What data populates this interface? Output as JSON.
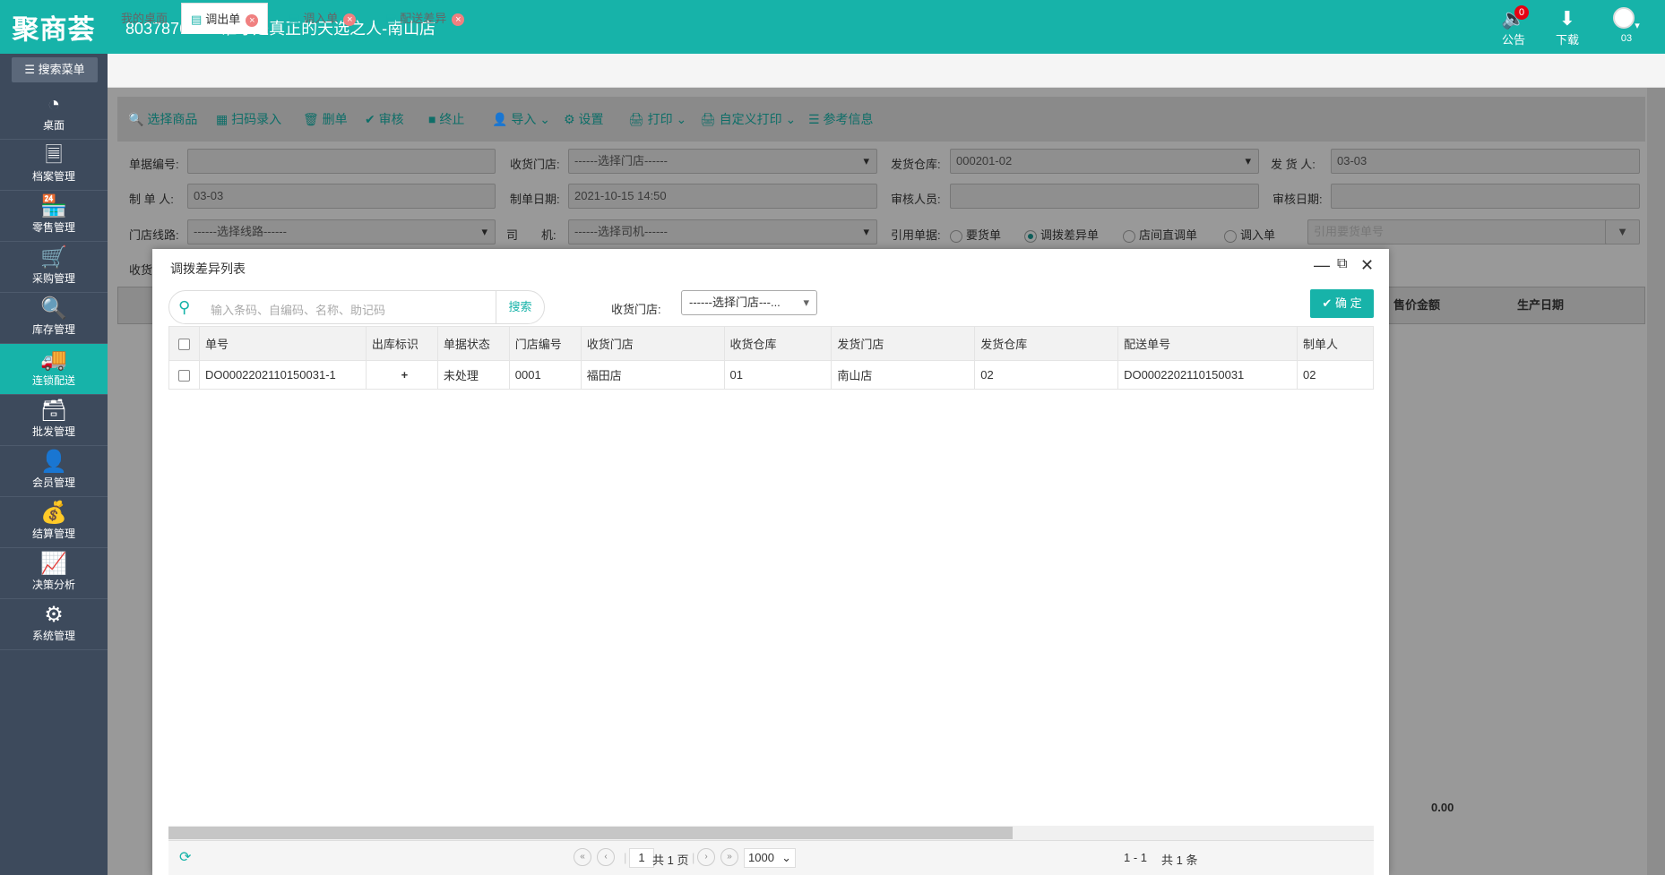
{
  "header": {
    "logo": "聚商荟",
    "title": "8037876350-谁才是真正的天选之人-南山店",
    "notice_label": "公告",
    "notice_count": "0",
    "download_label": "下载",
    "user_label": "03"
  },
  "sidebar": {
    "search_label": "搜索菜单",
    "items": [
      {
        "label": "桌面",
        "icon": "dashboard-icon"
      },
      {
        "label": "档案管理",
        "icon": "archive-icon"
      },
      {
        "label": "零售管理",
        "icon": "store-icon"
      },
      {
        "label": "采购管理",
        "icon": "cart-icon"
      },
      {
        "label": "库存管理",
        "icon": "inventory-icon"
      },
      {
        "label": "连锁配送",
        "icon": "truck-icon"
      },
      {
        "label": "批发管理",
        "icon": "wholesale-icon"
      },
      {
        "label": "会员管理",
        "icon": "member-icon"
      },
      {
        "label": "结算管理",
        "icon": "settlement-icon"
      },
      {
        "label": "决策分析",
        "icon": "chart-icon"
      },
      {
        "label": "系统管理",
        "icon": "gear-icon"
      }
    ]
  },
  "tabs": [
    {
      "label": "我的桌面"
    },
    {
      "label": "调出单"
    },
    {
      "label": "调入单"
    },
    {
      "label": "配送差异"
    }
  ],
  "toolbar": {
    "select_goods": "选择商品",
    "scan_entry": "扫码录入",
    "delete": "删单",
    "audit": "审核",
    "terminate": "终止",
    "import": "导入",
    "settings": "设置",
    "print": "打印",
    "custom_print": "自定义打印",
    "reference": "参考信息"
  },
  "form": {
    "doc_no_label": "单据编号:",
    "recv_store_label": "收货门店:",
    "recv_store_value": "------选择门店------",
    "send_wh_label": "发货仓库:",
    "send_wh_value": "000201-02",
    "sender_label": "发 货 人:",
    "sender_value": "03-03",
    "maker_label": "制 单 人:",
    "maker_value": "03-03",
    "make_date_label": "制单日期:",
    "make_date_value": "2021-10-15 14:50",
    "auditor_label": "审核人员:",
    "audit_date_label": "审核日期:",
    "route_label": "门店线路:",
    "route_value": "------选择线路------",
    "driver_label": "司　　机:",
    "driver_value": "------选择司机------",
    "ref_label": "引用单据:",
    "ref_options": [
      "要货单",
      "调拨差异单",
      "店间直调单",
      "调入单"
    ],
    "ref_placeholder": "引用要货单号",
    "recv_partial": "收货"
  },
  "bg_grid": {
    "col_price_amount": "售价金额",
    "col_prod_date": "生产日期",
    "total": "0.00"
  },
  "modal": {
    "title": "调拨差异列表",
    "search_placeholder": "输入条码、自编码、名称、助记码",
    "search_btn": "搜索",
    "store_label": "收货门店:",
    "store_value": "------选择门店---...",
    "ok_btn": "确 定",
    "columns": [
      "单号",
      "出库标识",
      "单据状态",
      "门店编号",
      "收货门店",
      "收货仓库",
      "发货门店",
      "发货仓库",
      "配送单号",
      "制单人"
    ],
    "rows": [
      [
        "DO0002202110150031-1",
        "+",
        "未处理",
        "0001",
        "福田店",
        "01",
        "南山店",
        "02",
        "DO0002202110150031",
        "02"
      ]
    ],
    "pager": {
      "page": "1",
      "total_pages": "共 1 页",
      "page_size": "1000",
      "range": "1 - 1",
      "total": "共 1 条"
    }
  },
  "colors": {
    "brand": "#17b3a9",
    "sidebar": "#3d4a5c"
  }
}
